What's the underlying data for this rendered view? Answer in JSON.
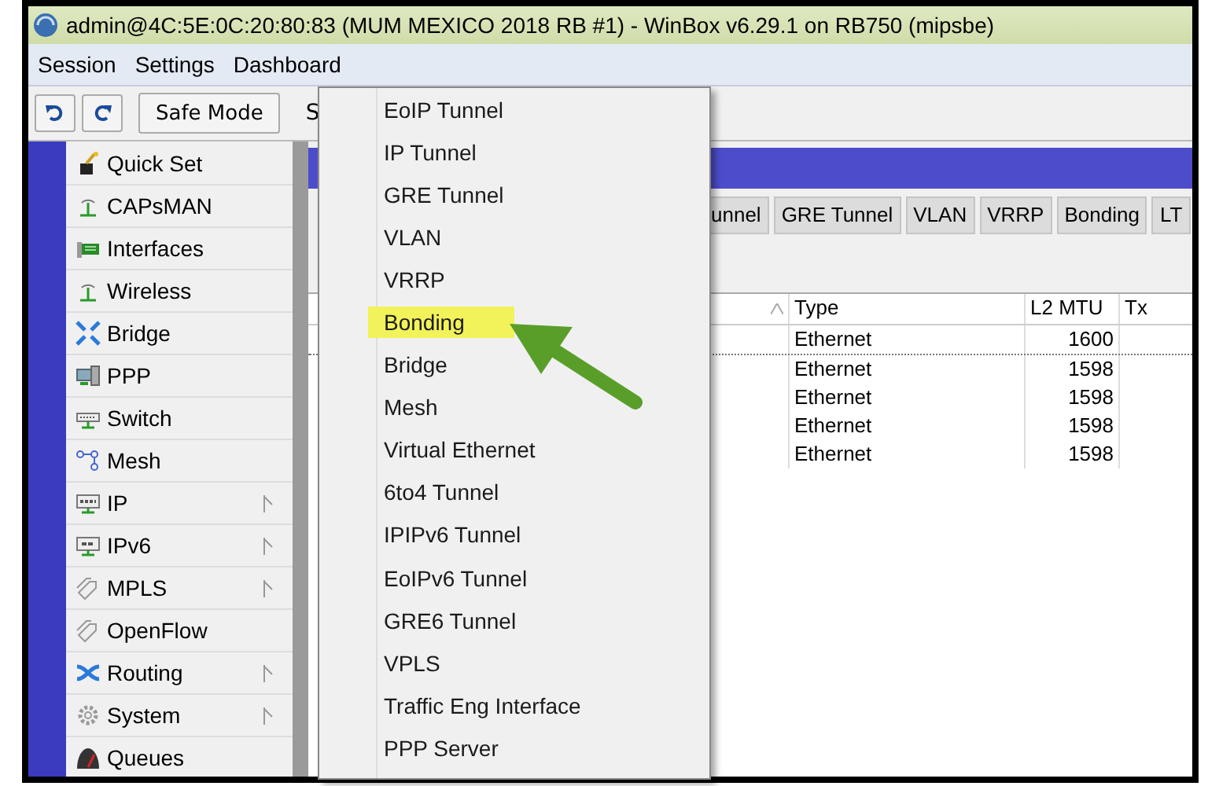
{
  "window": {
    "title": "admin@4C:5E:0C:20:80:83 (MUM MEXICO 2018 RB #1) - WinBox v6.29.1 on RB750 (mipsbe)"
  },
  "menu_bar": [
    "Session",
    "Settings",
    "Dashboard"
  ],
  "toolbar": {
    "safe_mode": "Safe Mode",
    "cut_label": "S"
  },
  "sidebar": {
    "items": [
      {
        "label": "Quick Set",
        "submenu": false
      },
      {
        "label": "CAPsMAN",
        "submenu": false
      },
      {
        "label": "Interfaces",
        "submenu": false
      },
      {
        "label": "Wireless",
        "submenu": false
      },
      {
        "label": "Bridge",
        "submenu": false
      },
      {
        "label": "PPP",
        "submenu": false
      },
      {
        "label": "Switch",
        "submenu": false
      },
      {
        "label": "Mesh",
        "submenu": false
      },
      {
        "label": "IP",
        "submenu": true
      },
      {
        "label": "IPv6",
        "submenu": true
      },
      {
        "label": "MPLS",
        "submenu": true
      },
      {
        "label": "OpenFlow",
        "submenu": false
      },
      {
        "label": "Routing",
        "submenu": true
      },
      {
        "label": "System",
        "submenu": true
      },
      {
        "label": "Queues",
        "submenu": false
      }
    ]
  },
  "interface_window": {
    "tabs": [
      "unnel",
      "GRE Tunnel",
      "VLAN",
      "VRRP",
      "Bonding",
      "LT"
    ],
    "table": {
      "columns": [
        "Type",
        "L2 MTU",
        "Tx"
      ],
      "rows": [
        [
          "Ethernet",
          "1600",
          ""
        ],
        [
          "Ethernet",
          "1598",
          ""
        ],
        [
          "Ethernet",
          "1598",
          ""
        ],
        [
          "Ethernet",
          "1598",
          ""
        ],
        [
          "Ethernet",
          "1598",
          ""
        ]
      ]
    }
  },
  "dropdown_menu": {
    "items": [
      {
        "label": "EoIP Tunnel",
        "highlighted": false
      },
      {
        "label": "IP Tunnel",
        "highlighted": false
      },
      {
        "label": "GRE Tunnel",
        "highlighted": false
      },
      {
        "label": "VLAN",
        "highlighted": false
      },
      {
        "label": "VRRP",
        "highlighted": false
      },
      {
        "label": "Bonding",
        "highlighted": true
      },
      {
        "label": "Bridge",
        "highlighted": false
      },
      {
        "label": "Mesh",
        "highlighted": false
      },
      {
        "label": "Virtual Ethernet",
        "highlighted": false
      },
      {
        "label": "6to4 Tunnel",
        "highlighted": false
      },
      {
        "label": "IPIPv6 Tunnel",
        "highlighted": false
      },
      {
        "label": "EoIPv6 Tunnel",
        "highlighted": false
      },
      {
        "label": "GRE6 Tunnel",
        "highlighted": false
      },
      {
        "label": "VPLS",
        "highlighted": false
      },
      {
        "label": "Traffic Eng Interface",
        "highlighted": false
      },
      {
        "label": "PPP Server",
        "highlighted": false
      }
    ]
  }
}
